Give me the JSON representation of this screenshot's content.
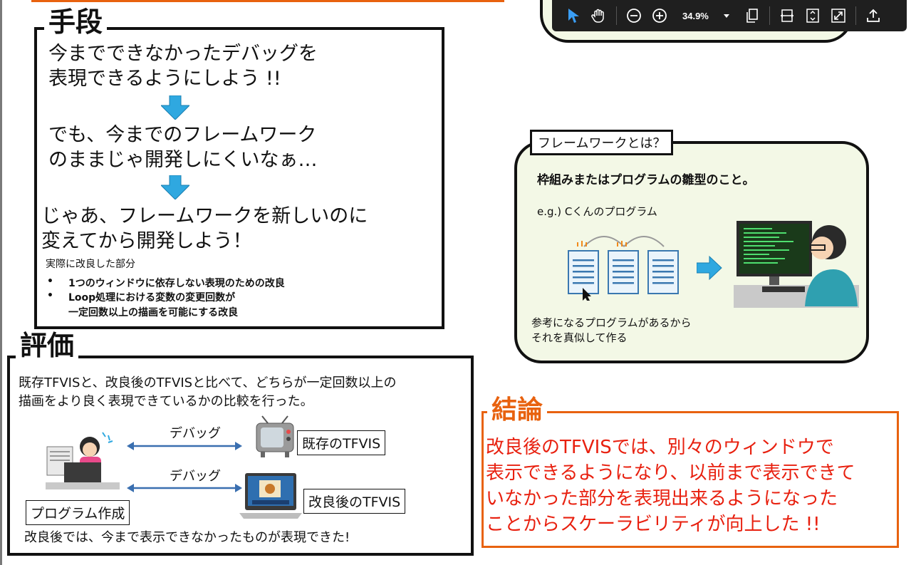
{
  "method": {
    "heading": "手段",
    "line1a": "今までできなかったデバッグを",
    "line1b": "表現できるようにしよう !!",
    "line2a": "でも、今までのフレームワーク",
    "line2b": "のままじゃ開発しにくいなぁ…",
    "line3a": "じゃあ、フレームワークを新しいのに",
    "line3b": "変えてから開発しよう！",
    "subheading": "実際に改良した部分",
    "bullets": [
      "1つのウィンドウに依存しない表現のための改良",
      "Loop処理における変数の変更回数が",
      "一定回数以上の描画を可能にする改良"
    ]
  },
  "evaluation": {
    "heading": "評価",
    "desc1": "既存TFVISと、改良後のTFVISと比べて、どちらが一定回数以上の",
    "desc2": "描画をより良く表現できているかの比較を行った。",
    "debug1": "デバッグ",
    "debug2": "デバッグ",
    "existing": "既存のTFVIS",
    "improved": "改良後のTFVIS",
    "program": "プログラム作成",
    "result": "改良後では、今まで表示できなかったものが表現できた!"
  },
  "framework": {
    "tag": "フレームワークとは？",
    "definition": "枠組みまたはプログラムの雛型のこと。",
    "example": "e.g.) Cくんのプログラム",
    "note1": "参考になるプログラムがあるから",
    "note2": "それを真似して作る"
  },
  "conclusion": {
    "heading": "結論",
    "lines": [
      "改良後のTFVISでは、別々のウィンドウで",
      "表示できるようになり、以前まで表示できて",
      "いなかった部分を表現出来るようになった",
      "ことからスケーラビリティが向上した !!"
    ]
  },
  "toolbar": {
    "zoom": "34.9%",
    "icons": [
      "select-pointer-icon",
      "hand-pan-icon",
      "zoom-out-icon",
      "zoom-in-icon",
      "zoom-dropdown-icon",
      "copy-icon",
      "fit-width-icon",
      "fit-page-icon",
      "fullscreen-icon",
      "upload-icon"
    ]
  },
  "colors": {
    "accent_orange": "#e8620f",
    "conclusion_red": "#e8200f",
    "arrow_blue": "#2fa8e0",
    "panel_bg": "#f3f8e6"
  }
}
